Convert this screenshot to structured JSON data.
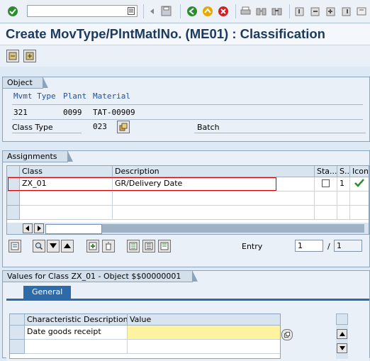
{
  "title": "Create MovType/PlntMatlNo. (ME01) : Classification",
  "object_group": {
    "label": "Object",
    "headers": [
      "Mvmt Type",
      "Plant",
      "Material"
    ],
    "values": [
      "321",
      "0099",
      "TAT-00909"
    ],
    "class_type_label": "Class Type",
    "class_type_value": "023",
    "class_type_text": "Batch"
  },
  "assignments": {
    "label": "Assignments",
    "columns": [
      "Class",
      "Description",
      "Sta...",
      "S...",
      "Icon"
    ],
    "rows": [
      {
        "class": "ZX_01",
        "description": "GR/Delivery Date",
        "status_value": "1"
      }
    ],
    "entry_label": "Entry",
    "entry_value": "1",
    "entry_sep": "/",
    "entry_total": "1"
  },
  "values_group": {
    "label": "Values for Class ZX_01 - Object $$00000001",
    "tab_label": "General",
    "columns": [
      "Characteristic Description",
      "Value"
    ],
    "rows": [
      {
        "description": "Date goods receipt",
        "value": ""
      }
    ]
  },
  "colors": {
    "title": "#1c3a5f",
    "header_blue": "#2050a0",
    "tab_active": "#2c6aa8",
    "selection_border": "#d40000",
    "value_yellow": "#fff3a0"
  }
}
